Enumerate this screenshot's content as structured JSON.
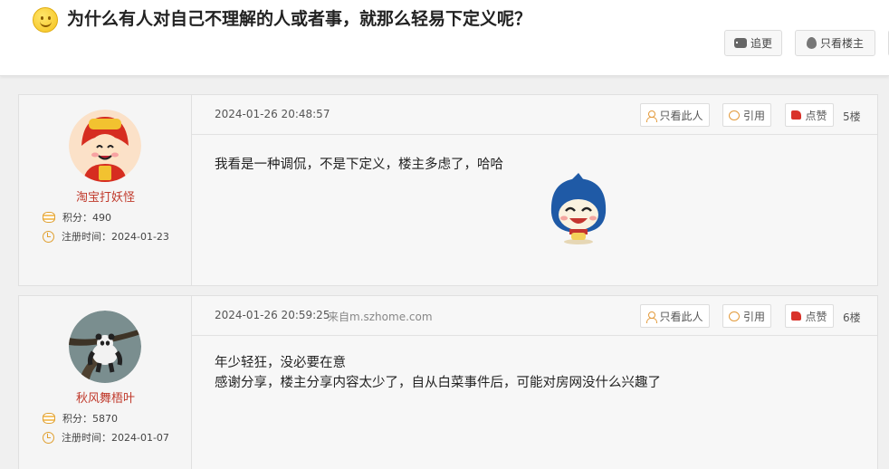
{
  "header": {
    "title": "为什么有人对自己不理解的人或者事，就那么轻易下定义呢？",
    "reply_label": "追更",
    "host_only_label": "只看楼主"
  },
  "posts": [
    {
      "username": "淘宝打妖怪",
      "points_label": "积分：",
      "points": "490",
      "reg_label": "注册时间：",
      "reg_date": "2024-01-23",
      "time": "2024-01-26 20:48:57",
      "source": "",
      "only_this_label": "只看此人",
      "quote_label": "引用",
      "like_label": "点赞",
      "floor": "5楼",
      "lines": [
        "我看是一种调侃，不是下定义，楼主多虑了，哈哈"
      ]
    },
    {
      "username": "秋风舞梧叶",
      "points_label": "积分：",
      "points": "5870",
      "reg_label": "注册时间：",
      "reg_date": "2024-01-07",
      "time": "2024-01-26 20:59:25",
      "source": "来自m.szhome.com",
      "only_this_label": "只看此人",
      "quote_label": "引用",
      "like_label": "点赞",
      "floor": "6楼",
      "lines": [
        "年少轻狂，没必要在意",
        "感谢分享，楼主分享内容太少了，自从白菜事件后，可能对房网没什么兴趣了"
      ]
    }
  ],
  "colors": {
    "username": "#c0392b",
    "accent": "#e39a3b",
    "like": "#d9322a"
  }
}
